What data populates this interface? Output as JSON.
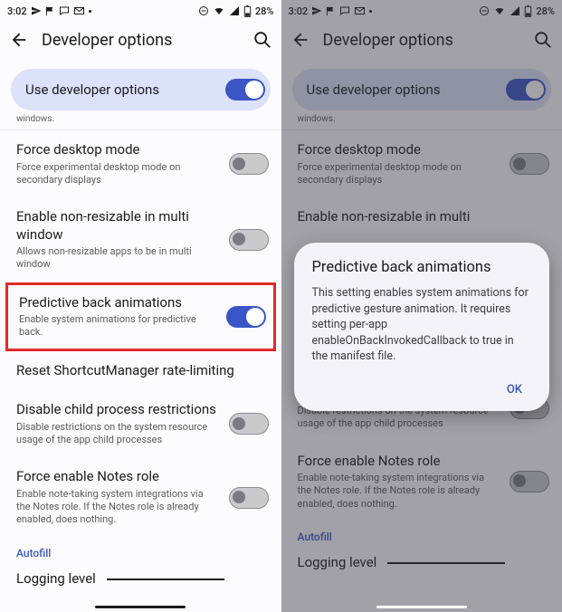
{
  "status": {
    "time": "3:02",
    "battery": "28%"
  },
  "appbar": {
    "title": "Developer options"
  },
  "master_toggle": {
    "label": "Use developer options"
  },
  "cutoff_left": "windows.",
  "cutoff_right": "windows.",
  "settings": {
    "force_desktop": {
      "title": "Force desktop mode",
      "sub": "Force experimental desktop mode on secondary displays"
    },
    "non_resizable": {
      "title": "Enable non-resizable in multi window",
      "sub": "Allows non-resizable apps to be in multi window"
    },
    "predictive": {
      "title": "Predictive back animations",
      "sub": "Enable system animations for predictive back."
    },
    "reset_scm": {
      "title": "Reset ShortcutManager rate-limiting"
    },
    "disable_child": {
      "title": "Disable child process restrictions",
      "sub": "Disable restrictions on the system resource usage of the app child processes"
    },
    "notes_role": {
      "title": "Force enable Notes role",
      "sub": "Enable note-taking system integrations via the Notes role. If the Notes role is already enabled, does nothing."
    }
  },
  "section": {
    "autofill": "Autofill"
  },
  "logging": {
    "label": "Logging level"
  },
  "dialog": {
    "title": "Predictive back animations",
    "body": "This setting enables system animations for predictive gesture animation. It requires setting per-app enableOnBackInvokedCallback to true in the manifest file.",
    "ok": "OK"
  },
  "right_non_resizable_title_truncated": "Enable non-resizable in multi"
}
